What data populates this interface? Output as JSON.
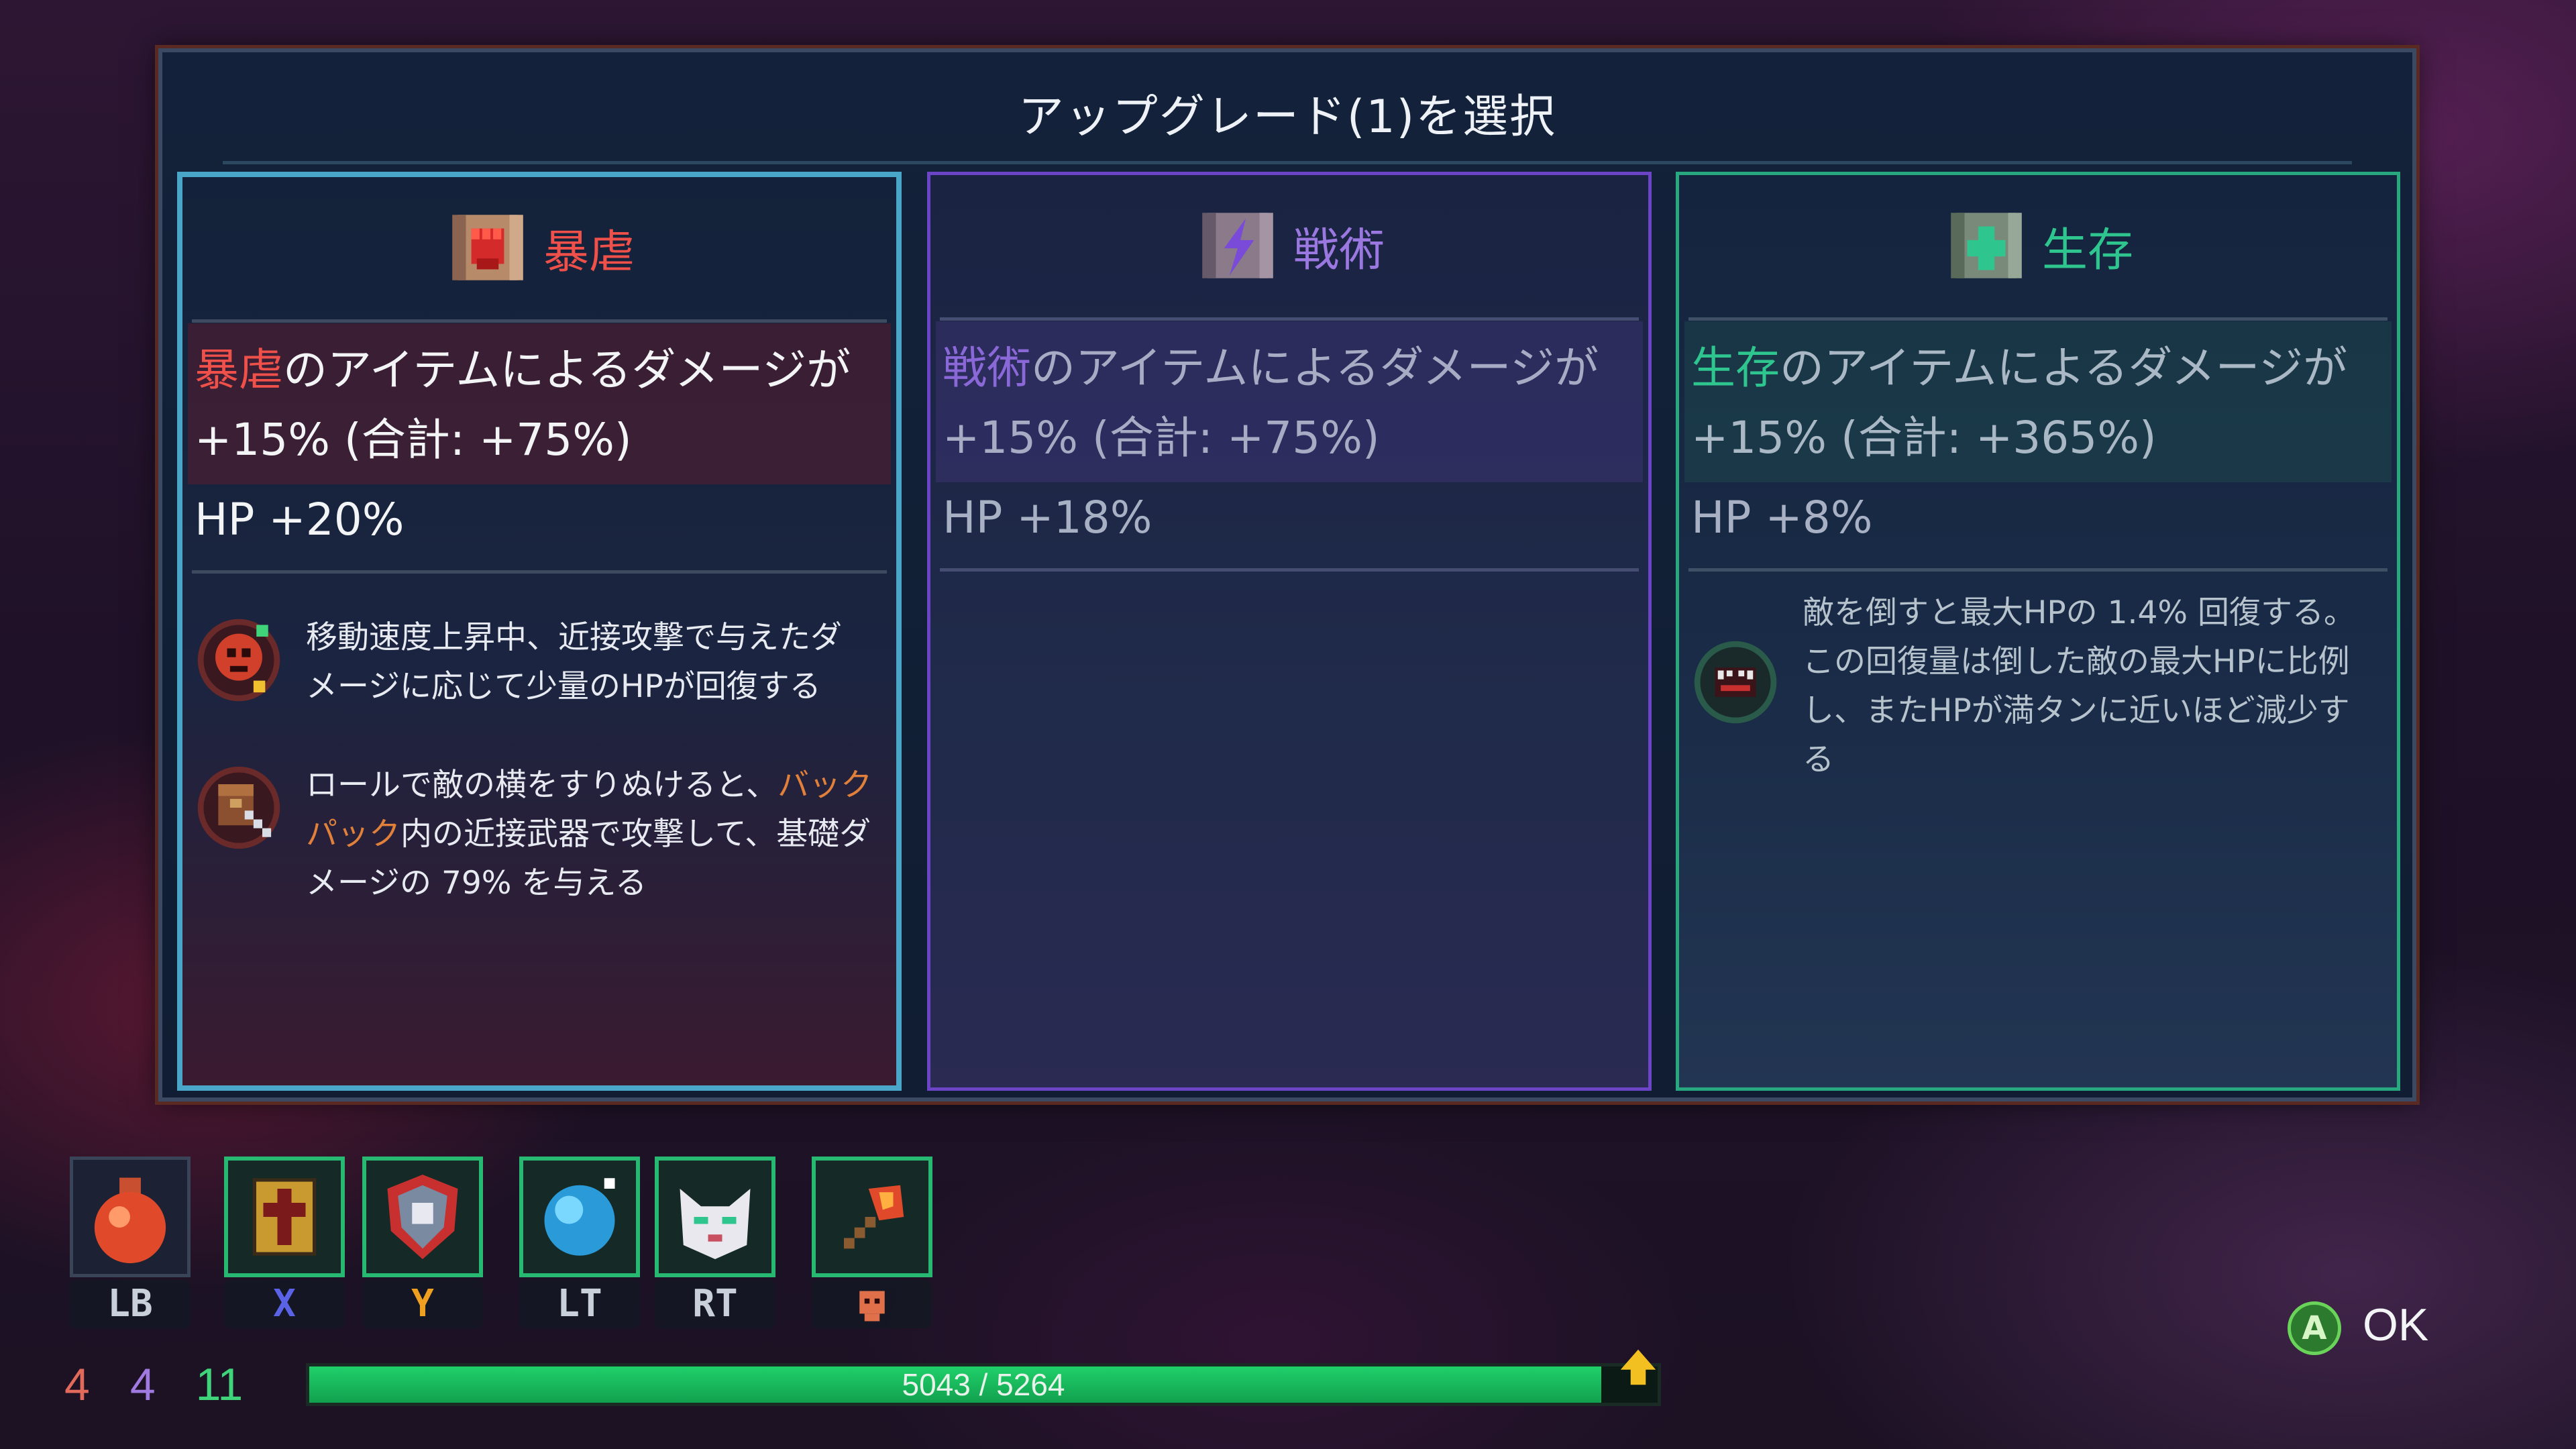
{
  "dialog": {
    "title": "アップグレード(1)を選択"
  },
  "cards": [
    {
      "name": "暴虐",
      "color": "#f0504a",
      "dmg_hl": "暴虐",
      "dmg_rest": "のアイテムによるダメージが",
      "dmg_line2": "+15% (合計: +75%)",
      "hp": "HP +20%",
      "perks": [
        {
          "icon": "vampiric-fist-icon",
          "lines": [
            "移動速度上昇中、近接攻撃で与えたダ",
            "メージに応じて少量のHPが回復する"
          ]
        },
        {
          "icon": "backpack-blade-icon",
          "l1_a": "ロールで敵の横をすりぬけると、",
          "l1_b": "バック",
          "l2_a": "パック",
          "l2_b": "内の近接武器で攻撃して、基礎ダ",
          "l3": "メージの 79% を与える"
        }
      ]
    },
    {
      "name": "戦術",
      "color": "#8a68d8",
      "dmg_hl": "戦術",
      "dmg_rest": "のアイテムによるダメージが",
      "dmg_line2": "+15% (合計: +75%)",
      "hp": "HP +18%"
    },
    {
      "name": "生存",
      "color": "#2fc58f",
      "dmg_hl": "生存",
      "dmg_rest": "のアイテムによるダメージが",
      "dmg_line2": "+15% (合計: +365%)",
      "hp": "HP +8%",
      "perk": {
        "icon": "fanged-maw-icon",
        "lines": [
          "敵を倒すと最大HPの 1.4% 回復する。",
          "この回復量は倒した敵の最大HPに比例",
          "し、またHPが満タンに近いほど減少す",
          "る"
        ]
      }
    }
  ],
  "hotbar": [
    {
      "label": "LB",
      "icon": "health-flask-icon"
    },
    {
      "label": "X",
      "icon": "cross-tome-icon"
    },
    {
      "label": "Y",
      "icon": "shield-emblem-icon"
    },
    {
      "label": "LT",
      "icon": "ice-orb-icon"
    },
    {
      "label": "RT",
      "icon": "cat-mask-icon"
    },
    {
      "label": "",
      "icon": "fire-axe-icon",
      "label_icon": "skull-button-icon"
    }
  ],
  "stats": {
    "brutality": "4",
    "tactics": "4",
    "survival": "11"
  },
  "hp": {
    "current": 5043,
    "max": 5264,
    "text": "5043 / 5264"
  },
  "ok": {
    "button": "A",
    "label": "OK"
  }
}
